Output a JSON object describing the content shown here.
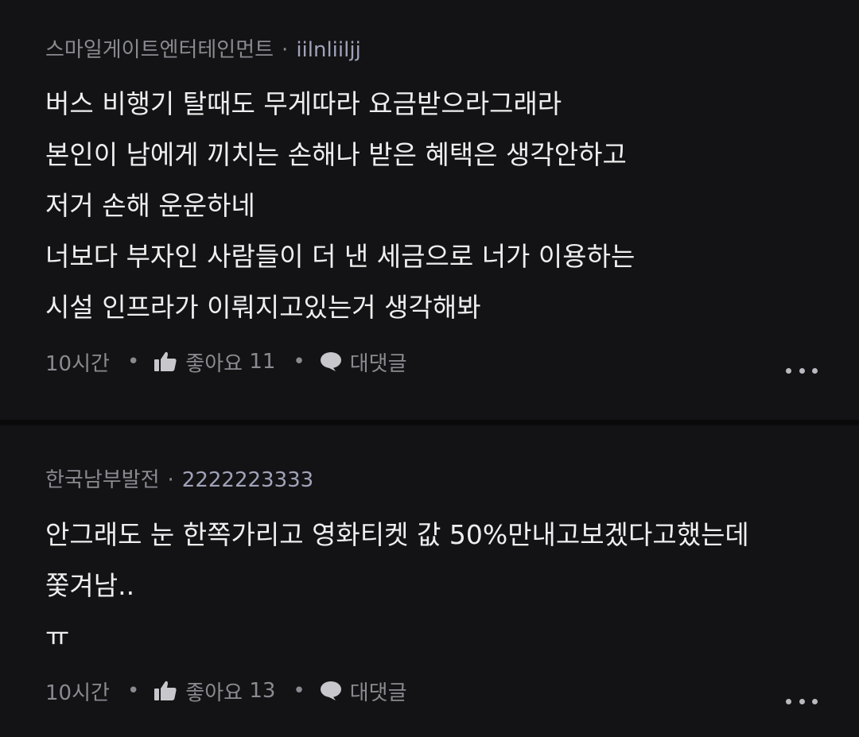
{
  "comments": [
    {
      "author": "스마일게이트엔터테인먼트",
      "separator": "·",
      "username": "iilnliiljj",
      "lines": [
        "버스 비행기 탈때도 무게따라 요금받으라그래라",
        "본인이 남에게 끼치는 손해나 받은 혜택은 생각안하고",
        "저거 손해 운운하네",
        "너보다 부자인 사람들이 더 낸 세금으로 너가 이용하는",
        "시설 인프라가 이뤄지고있는거 생각해봐"
      ],
      "time": "10시간",
      "like_label": "좋아요",
      "like_count": "11",
      "reply_label": "대댓글",
      "icons": {
        "like": "thumbs-up-icon",
        "reply": "speech-bubble-icon",
        "more": "more-options-icon"
      }
    },
    {
      "author": "한국남부발전",
      "separator": "·",
      "username": "2222223333",
      "lines": [
        "안그래도 눈 한쪽가리고 영화티켓 값 50%만내고보겠다고했는데",
        "쫓겨남..",
        "ㅠ"
      ],
      "time": "10시간",
      "like_label": "좋아요",
      "like_count": "13",
      "reply_label": "대댓글",
      "icons": {
        "like": "thumbs-up-icon",
        "reply": "speech-bubble-icon",
        "more": "more-options-icon"
      }
    }
  ],
  "action_separator": "•",
  "colors": {
    "background": "#131315",
    "text": "#eeeeee",
    "meta": "#8a8a91"
  }
}
